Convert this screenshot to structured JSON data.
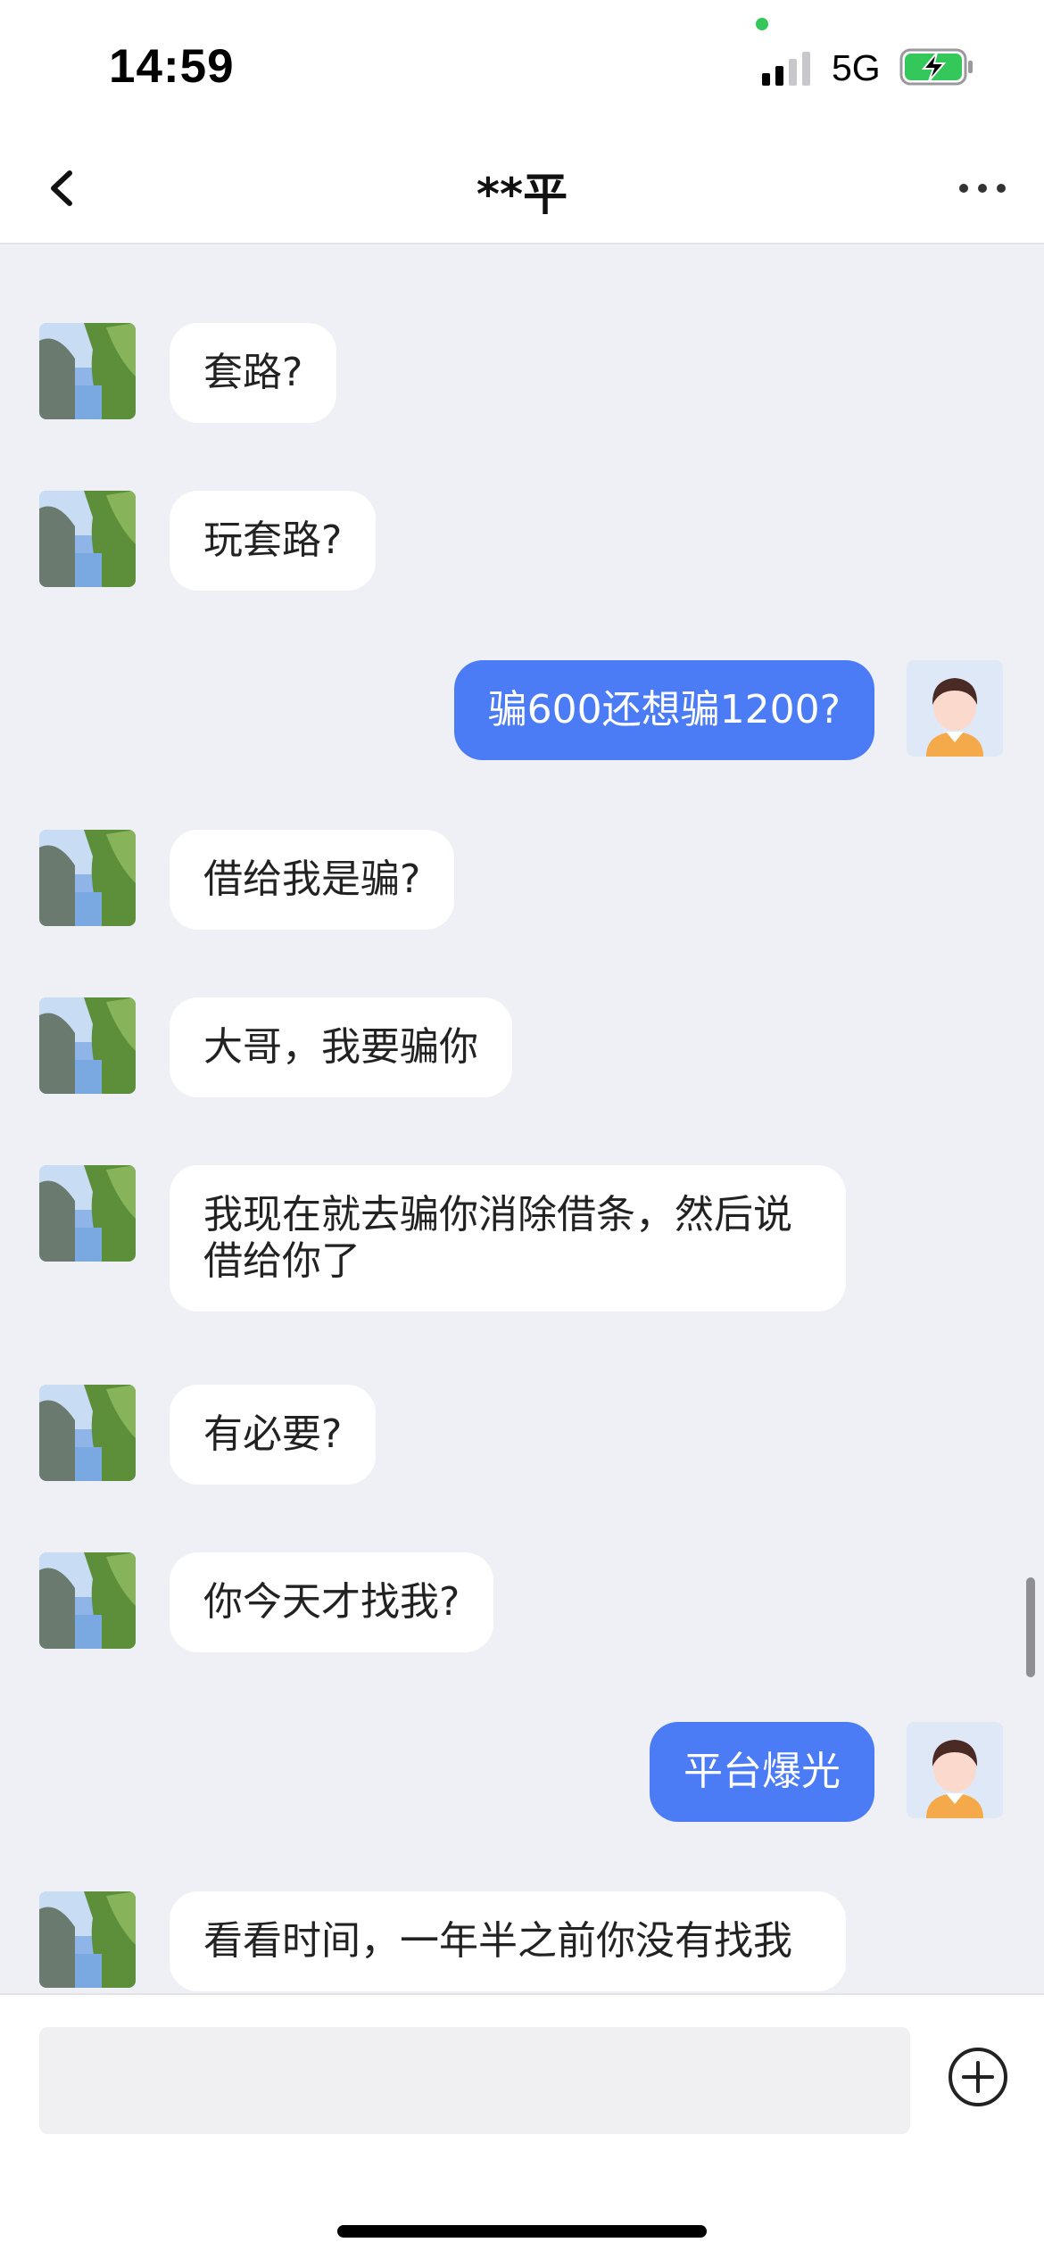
{
  "status_bar": {
    "time": "14:59",
    "network": "5G",
    "signal_icon": "cellular-signal-icon",
    "battery_icon": "battery-charging-icon",
    "battery_color": "#34c759",
    "privacy_dot_color": "#34c759"
  },
  "header": {
    "title": "**平",
    "back_icon": "chevron-left-icon",
    "more_icon": "more-horizontal-icon"
  },
  "messages": [
    {
      "side": "incoming",
      "text": "套路?"
    },
    {
      "side": "incoming",
      "text": "玩套路?"
    },
    {
      "side": "outgoing",
      "text": "骗600还想骗1200?"
    },
    {
      "side": "incoming",
      "text": "借给我是骗?"
    },
    {
      "side": "incoming",
      "text": "大哥，我要骗你"
    },
    {
      "side": "incoming",
      "text": "我现在就去骗你消除借条，然后说借给你了"
    },
    {
      "side": "incoming",
      "text": "有必要?"
    },
    {
      "side": "incoming",
      "text": "你今天才找我?"
    },
    {
      "side": "outgoing",
      "text": "平台爆光"
    },
    {
      "side": "incoming",
      "text": "看看时间，一年半之前你没有找我"
    }
  ],
  "composer": {
    "input_value": "",
    "add_icon": "plus-circle-icon"
  },
  "colors": {
    "outgoing_bubble": "#4b7bf5",
    "incoming_bubble": "#ffffff",
    "chat_background": "#eff0f5"
  }
}
